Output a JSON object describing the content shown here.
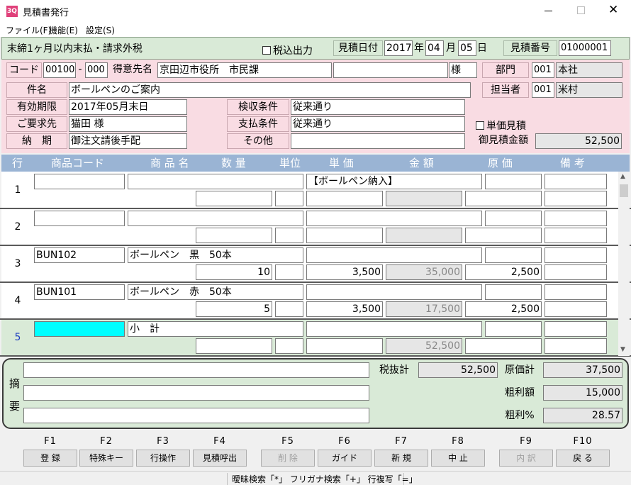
{
  "window": {
    "title": "見積書発行",
    "app_icon": "3Q"
  },
  "menu": [
    "ファイル(F)",
    "機能(E)",
    "設定(S)"
  ],
  "header": {
    "terms": "末締1ヶ月以内末払・請求外税",
    "tax_inclusive_label": "税込出力",
    "date_label": "見積日付",
    "year": "2017",
    "year_unit": "年",
    "month": "04",
    "month_unit": "月",
    "day": "05",
    "day_unit": "日",
    "number_label": "見積番号",
    "number": "01000001"
  },
  "customer": {
    "code_label": "コード",
    "code1": "00100",
    "dash": "-",
    "code2": "000",
    "name_label": "得意先名",
    "name": "京田辺市役所　市民課",
    "name2": "",
    "honorific": "様",
    "dept_label": "部門",
    "dept_code": "001",
    "dept_name": "本社",
    "subject_label": "件名",
    "subject": "ボールペンのご案内",
    "staff_label": "担当者",
    "staff_code": "001",
    "staff_name": "米村",
    "validity_label": "有効期限",
    "validity": "2017年05月末日",
    "requester_label": "ご要求先",
    "requester": "猫田 様",
    "delivery_label": "納　期",
    "delivery": "御注文請後手配",
    "inspection_label": "検収条件",
    "inspection": "従来通り",
    "payment_label": "支払条件",
    "payment": "従来通り",
    "other_label": "その他",
    "other": "",
    "unit_price_label": "単価見積",
    "total_label": "御見積金額",
    "total": "52,500"
  },
  "columns": {
    "row": "行",
    "code": "商品コード",
    "name": "商 品 名",
    "qty": "数 量",
    "unit": "単位",
    "price": "単 価",
    "amount": "金 額",
    "cost": "原 価",
    "note": "備 考"
  },
  "rows": [
    {
      "no": "1",
      "code": "",
      "name": "",
      "desc": "【ボールペン納入】",
      "cost_top": "",
      "note_top": "",
      "qty": "",
      "unit": "",
      "price": "",
      "amount": "",
      "cost": "",
      "note": ""
    },
    {
      "no": "2",
      "code": "",
      "name": "",
      "desc": "",
      "cost_top": "",
      "note_top": "",
      "qty": "",
      "unit": "",
      "price": "",
      "amount": "",
      "cost": "",
      "note": ""
    },
    {
      "no": "3",
      "code": "BUN102",
      "name": "ボールペン　黒　50本",
      "desc": "",
      "cost_top": "",
      "note_top": "",
      "qty": "10",
      "unit": "",
      "price": "3,500",
      "amount": "35,000",
      "cost": "2,500",
      "note": ""
    },
    {
      "no": "4",
      "code": "BUN101",
      "name": "ボールペン　赤　50本",
      "desc": "",
      "cost_top": "",
      "note_top": "",
      "qty": "5",
      "unit": "",
      "price": "3,500",
      "amount": "17,500",
      "cost": "2,500",
      "note": ""
    },
    {
      "no": "5",
      "code": "",
      "name": "小　計",
      "desc": "",
      "cost_top": "",
      "note_top": "",
      "qty": "",
      "unit": "",
      "price": "",
      "amount": "52,500",
      "cost": "",
      "note": ""
    }
  ],
  "summary": {
    "memo_label1": "摘",
    "memo_label2": "要",
    "memo1": "",
    "memo2": "",
    "memo3": "",
    "pretax_label": "税抜計",
    "pretax": "52,500",
    "cost_label": "原価計",
    "cost": "37,500",
    "profit_label": "粗利額",
    "profit": "15,000",
    "margin_label": "粗利%",
    "margin": "28.57"
  },
  "fkeys": [
    {
      "key": "F1",
      "label": "登 録",
      "enabled": true
    },
    {
      "key": "F2",
      "label": "特殊キー",
      "enabled": true
    },
    {
      "key": "F3",
      "label": "行操作",
      "enabled": true
    },
    {
      "key": "F4",
      "label": "見積呼出",
      "enabled": true
    },
    {
      "key": "F5",
      "label": "削 除",
      "enabled": false
    },
    {
      "key": "F6",
      "label": "ガイド",
      "enabled": true
    },
    {
      "key": "F7",
      "label": "新 規",
      "enabled": true
    },
    {
      "key": "F8",
      "label": "中 止",
      "enabled": true
    },
    {
      "key": "F9",
      "label": "内 訳",
      "enabled": false
    },
    {
      "key": "F10",
      "label": "戻 る",
      "enabled": true
    }
  ],
  "status": "曖昧検索「*」 フリガナ検索「+」 行複写「=」",
  "colors": {
    "header_green": "#d9ead7",
    "customer_pink": "#f9dce3",
    "grid_header": "#9ab4d4",
    "selected_cell": "#00ffff",
    "selected_row": "#d9ead7"
  }
}
